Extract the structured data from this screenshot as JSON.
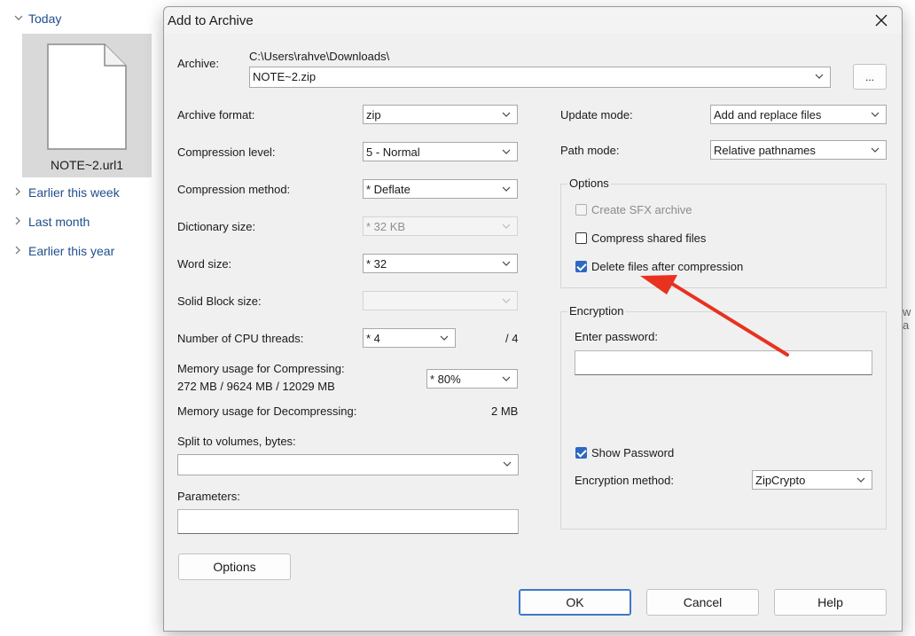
{
  "explorer": {
    "groups": {
      "today": "Today",
      "earlier_week": "Earlier this week",
      "last_month": "Last month",
      "earlier_year": "Earlier this year"
    },
    "file_name": "NOTE~2.url1",
    "edge_text": "w a"
  },
  "dialog": {
    "title": "Add to Archive",
    "archive": {
      "label": "Archive:",
      "path": "C:\\Users\\rahve\\Downloads\\",
      "name": "NOTE~2.zip",
      "browse_label": "..."
    },
    "left": {
      "archive_format": {
        "label": "Archive format:",
        "value": "zip"
      },
      "compression_level": {
        "label": "Compression level:",
        "value": "5 - Normal"
      },
      "compression_method": {
        "label": "Compression method:",
        "value": "* Deflate"
      },
      "dictionary_size": {
        "label": "Dictionary size:",
        "value": "* 32 KB"
      },
      "word_size": {
        "label": "Word size:",
        "value": "* 32"
      },
      "solid_block": {
        "label": "Solid Block size:",
        "value": ""
      },
      "cpu_threads": {
        "label": "Number of CPU threads:",
        "value": "* 4",
        "total": "/ 4"
      },
      "mem_compress": {
        "label": "Memory usage for Compressing:",
        "detail": "272 MB / 9624 MB / 12029 MB",
        "value": "* 80%"
      },
      "mem_decompress": {
        "label": "Memory usage for Decompressing:",
        "value": "2 MB"
      },
      "split": {
        "label": "Split to volumes, bytes:",
        "value": ""
      },
      "parameters": {
        "label": "Parameters:",
        "value": ""
      },
      "options_button": "Options"
    },
    "right": {
      "update_mode": {
        "label": "Update mode:",
        "value": "Add and replace files"
      },
      "path_mode": {
        "label": "Path mode:",
        "value": "Relative pathnames"
      },
      "options_group": {
        "title": "Options",
        "create_sfx": {
          "label": "Create SFX archive",
          "checked": false,
          "enabled": false
        },
        "compress_shared": {
          "label": "Compress shared files",
          "checked": false
        },
        "delete_after": {
          "label": "Delete files after compression",
          "checked": true
        }
      },
      "encryption": {
        "title": "Encryption",
        "password_label": "Enter password:",
        "password_value": "",
        "show_password": {
          "label": "Show Password",
          "checked": true
        },
        "method_label": "Encryption method:",
        "method_value": "ZipCrypto"
      }
    },
    "buttons": {
      "ok": "OK",
      "cancel": "Cancel",
      "help": "Help"
    }
  },
  "colors": {
    "accent": "#2d69c2",
    "annotation_arrow": "#e8321f",
    "file_tile": "#d9d9d9"
  }
}
